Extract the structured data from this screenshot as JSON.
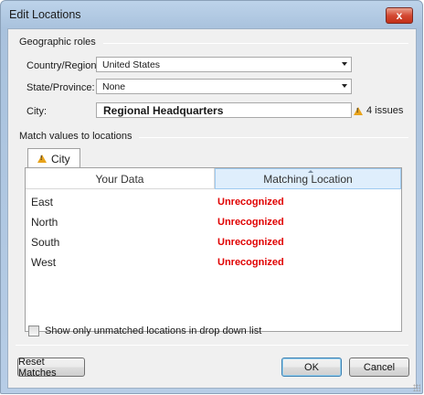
{
  "window": {
    "title": "Edit Locations",
    "close_glyph": "x"
  },
  "geographic_roles": {
    "header": "Geographic roles",
    "country_label": "Country/Region:",
    "country_value": "United States",
    "state_label": "State/Province:",
    "state_value": "None",
    "city_label": "City:",
    "city_value": "Regional Headquarters",
    "issues_text": "4 issues"
  },
  "match_section": {
    "header": "Match values to locations",
    "tab_label": "City",
    "columns": [
      "Your Data",
      "Matching Location"
    ],
    "rows": [
      {
        "data": "East",
        "match": "Unrecognized"
      },
      {
        "data": "North",
        "match": "Unrecognized"
      },
      {
        "data": "South",
        "match": "Unrecognized"
      },
      {
        "data": "West",
        "match": "Unrecognized"
      }
    ]
  },
  "checkbox_label": "Show only unmatched locations in drop down list",
  "buttons": {
    "reset": "Reset Matches",
    "ok": "OK",
    "cancel": "Cancel"
  },
  "colors": {
    "unrecognized": "#e00000",
    "warning": "#e8a31b",
    "selected_header": "#dfeefc"
  }
}
